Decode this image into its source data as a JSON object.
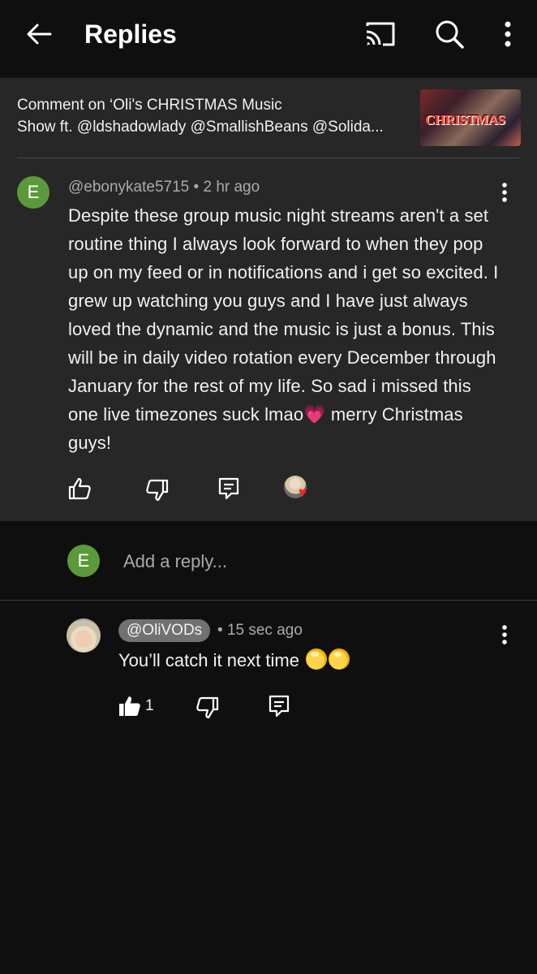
{
  "header": {
    "title": "Replies",
    "icons": {
      "back": "arrow-left-icon",
      "cast": "cast-icon",
      "search": "search-icon",
      "more": "more-vertical-icon"
    }
  },
  "video_ref": {
    "line1": "Comment on ‘Oli's CHRISTMAS Music",
    "line2": "Show ft. @ldshadowlady @SmallishBeans @Solida...",
    "thumbnail_text": "CHRISTMAS"
  },
  "main_comment": {
    "avatar_letter": "E",
    "author": "@ebonykate5715",
    "separator": " • ",
    "time": "2 hr ago",
    "text": "Despite these group music night streams aren't a set routine thing I always look forward to when they pop up on my feed or in notifications and i get so excited.  I grew up watching you guys and I have just always loved the dynamic and the music is just a bonus. This will be in daily video rotation every December through January for the rest of my life. So sad i missed this one live timezones suck lmao💗 merry Christmas guys!",
    "icons": {
      "like": "thumbs-up-icon",
      "dislike": "thumbs-down-icon",
      "reply": "reply-icon",
      "creator_heart": "creator-heart-icon",
      "more": "more-vertical-icon"
    },
    "heart_glyph": "♥"
  },
  "reply_box": {
    "avatar_letter": "E",
    "placeholder": "Add a reply..."
  },
  "reply": {
    "author": "@OliVODs",
    "separator": "• ",
    "time": "15 sec ago",
    "text": "You’ll catch it next time",
    "like_count": "1",
    "icons": {
      "like": "thumbs-up-filled-icon",
      "dislike": "thumbs-down-icon",
      "reply": "reply-icon",
      "more": "more-vertical-icon",
      "emoji": "salute-emoji-icon"
    }
  },
  "colors": {
    "background": "#0f0f0f",
    "card": "#272727",
    "secondary_text": "#aaaaaa",
    "avatar_green": "#5a9a3a",
    "heart_red": "#ff2020",
    "handle_chip": "#717171"
  }
}
